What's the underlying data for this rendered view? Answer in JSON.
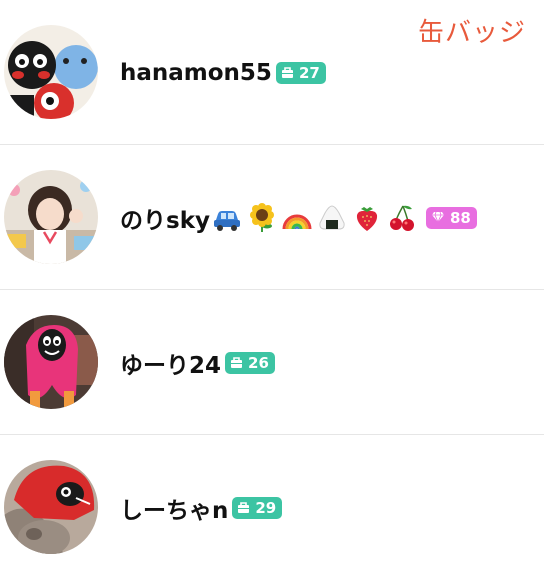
{
  "header": {
    "label": "缶バッジ"
  },
  "users": [
    {
      "name": "hanamon55",
      "badge_count": "27",
      "badge_type": "bag-icon",
      "badge_color": "#3cc4a3",
      "emojis": []
    },
    {
      "name": "のりsky",
      "badge_count": "88",
      "badge_type": "diamond-icon",
      "badge_color": "#e86ee0",
      "emojis": [
        "car-emoji",
        "sunflower-emoji",
        "rainbow-emoji",
        "rice-ball-emoji",
        "strawberry-emoji",
        "cherries-emoji"
      ]
    },
    {
      "name": "ゆーり24",
      "badge_count": "26",
      "badge_type": "bag-icon",
      "badge_color": "#3cc4a3",
      "emojis": []
    },
    {
      "name": "しーちゃn",
      "badge_count": "29",
      "badge_type": "bag-icon",
      "badge_color": "#3cc4a3",
      "emojis": []
    }
  ]
}
